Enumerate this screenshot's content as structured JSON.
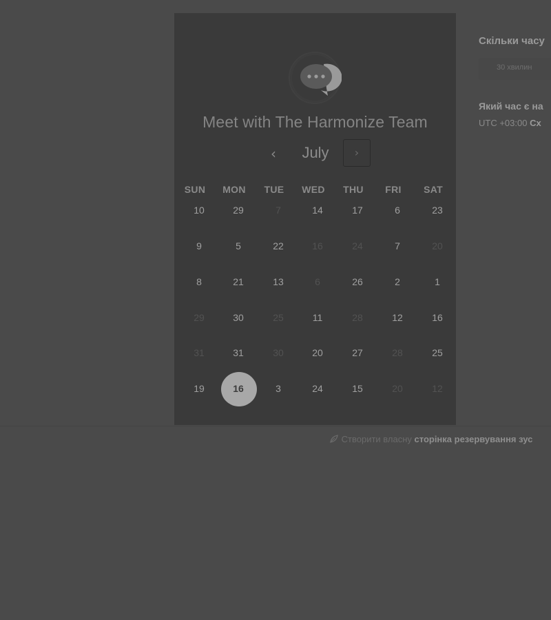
{
  "booking_panel": {
    "title": "Meet with The Harmonize Team",
    "logo_icon": "chat-bubble-ellipsis-icon",
    "month": "July",
    "prev_icon": "‹",
    "next_icon": "›",
    "weekdays": [
      "SUN",
      "MON",
      "TUE",
      "WED",
      "THU",
      "FRI",
      "SAT"
    ],
    "weeks": [
      [
        {
          "d": "10",
          "on": true
        },
        {
          "d": "29",
          "on": true
        },
        {
          "d": "7",
          "on": false
        },
        {
          "d": "14",
          "on": true
        },
        {
          "d": "17",
          "on": true
        },
        {
          "d": "6",
          "on": true
        },
        {
          "d": "23",
          "on": true
        }
      ],
      [
        {
          "d": "9",
          "on": true
        },
        {
          "d": "5",
          "on": true
        },
        {
          "d": "22",
          "on": true
        },
        {
          "d": "16",
          "on": false
        },
        {
          "d": "24",
          "on": false
        },
        {
          "d": "7",
          "on": true
        },
        {
          "d": "20",
          "on": false
        }
      ],
      [
        {
          "d": "8",
          "on": true
        },
        {
          "d": "21",
          "on": true
        },
        {
          "d": "13",
          "on": true
        },
        {
          "d": "6",
          "on": false
        },
        {
          "d": "26",
          "on": true
        },
        {
          "d": "2",
          "on": true
        },
        {
          "d": "1",
          "on": true
        }
      ],
      [
        {
          "d": "29",
          "on": false
        },
        {
          "d": "30",
          "on": true
        },
        {
          "d": "25",
          "on": false
        },
        {
          "d": "11",
          "on": true
        },
        {
          "d": "28",
          "on": false
        },
        {
          "d": "12",
          "on": true
        },
        {
          "d": "16",
          "on": true
        }
      ],
      [
        {
          "d": "31",
          "on": false
        },
        {
          "d": "31",
          "on": true
        },
        {
          "d": "30",
          "on": false
        },
        {
          "d": "20",
          "on": true
        },
        {
          "d": "27",
          "on": true
        },
        {
          "d": "28",
          "on": false
        },
        {
          "d": "25",
          "on": true
        }
      ],
      [
        {
          "d": "19",
          "on": true
        },
        {
          "d": "16",
          "on": true,
          "selected": true
        },
        {
          "d": "3",
          "on": true
        },
        {
          "d": "24",
          "on": true
        },
        {
          "d": "15",
          "on": true
        },
        {
          "d": "20",
          "on": false
        },
        {
          "d": "12",
          "on": false
        }
      ]
    ]
  },
  "details": {
    "duration_title": "Скільки часу",
    "duration_option": "30 хвилин",
    "time_title": "Який час є на",
    "timezone_prefix": "UTC +03:00",
    "timezone_name": "Сх"
  },
  "footer": {
    "icon": "leaf-icon",
    "prefix": "Створити власну",
    "link": "сторінка резервування зус"
  },
  "colors": {
    "page_bg": "#4a4a4a",
    "panel_bg": "#3a3a3a",
    "selected_day_bg": "#a8a8a8"
  }
}
